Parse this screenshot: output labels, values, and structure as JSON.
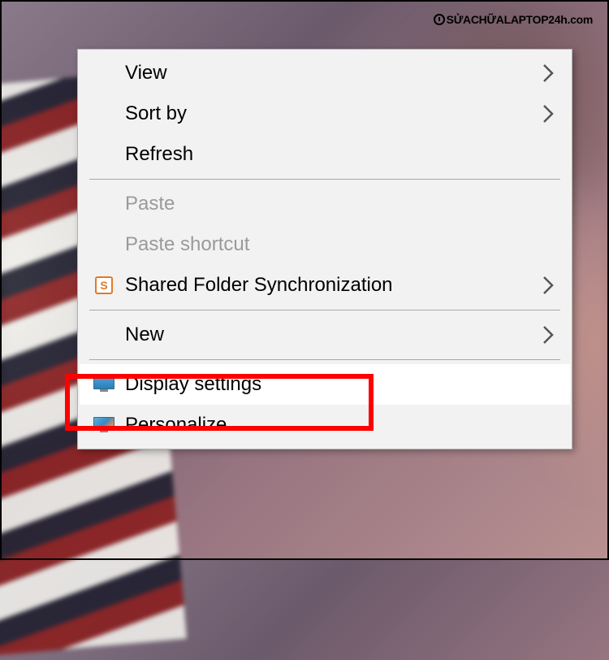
{
  "watermark": "SỬACHỮALAPTOP24h.com",
  "menu": {
    "view": {
      "label": "View",
      "has_submenu": true
    },
    "sort_by": {
      "label": "Sort by",
      "has_submenu": true
    },
    "refresh": {
      "label": "Refresh",
      "has_submenu": false
    },
    "paste": {
      "label": "Paste",
      "disabled": true
    },
    "paste_shortcut": {
      "label": "Paste shortcut",
      "disabled": true
    },
    "shared_folder": {
      "label": "Shared Folder Synchronization",
      "has_submenu": true,
      "icon": "s-sync-icon"
    },
    "new": {
      "label": "New",
      "has_submenu": true
    },
    "display_settings": {
      "label": "Display settings",
      "icon": "monitor-icon",
      "highlighted": true
    },
    "personalize": {
      "label": "Personalize",
      "icon": "personalize-icon"
    }
  }
}
